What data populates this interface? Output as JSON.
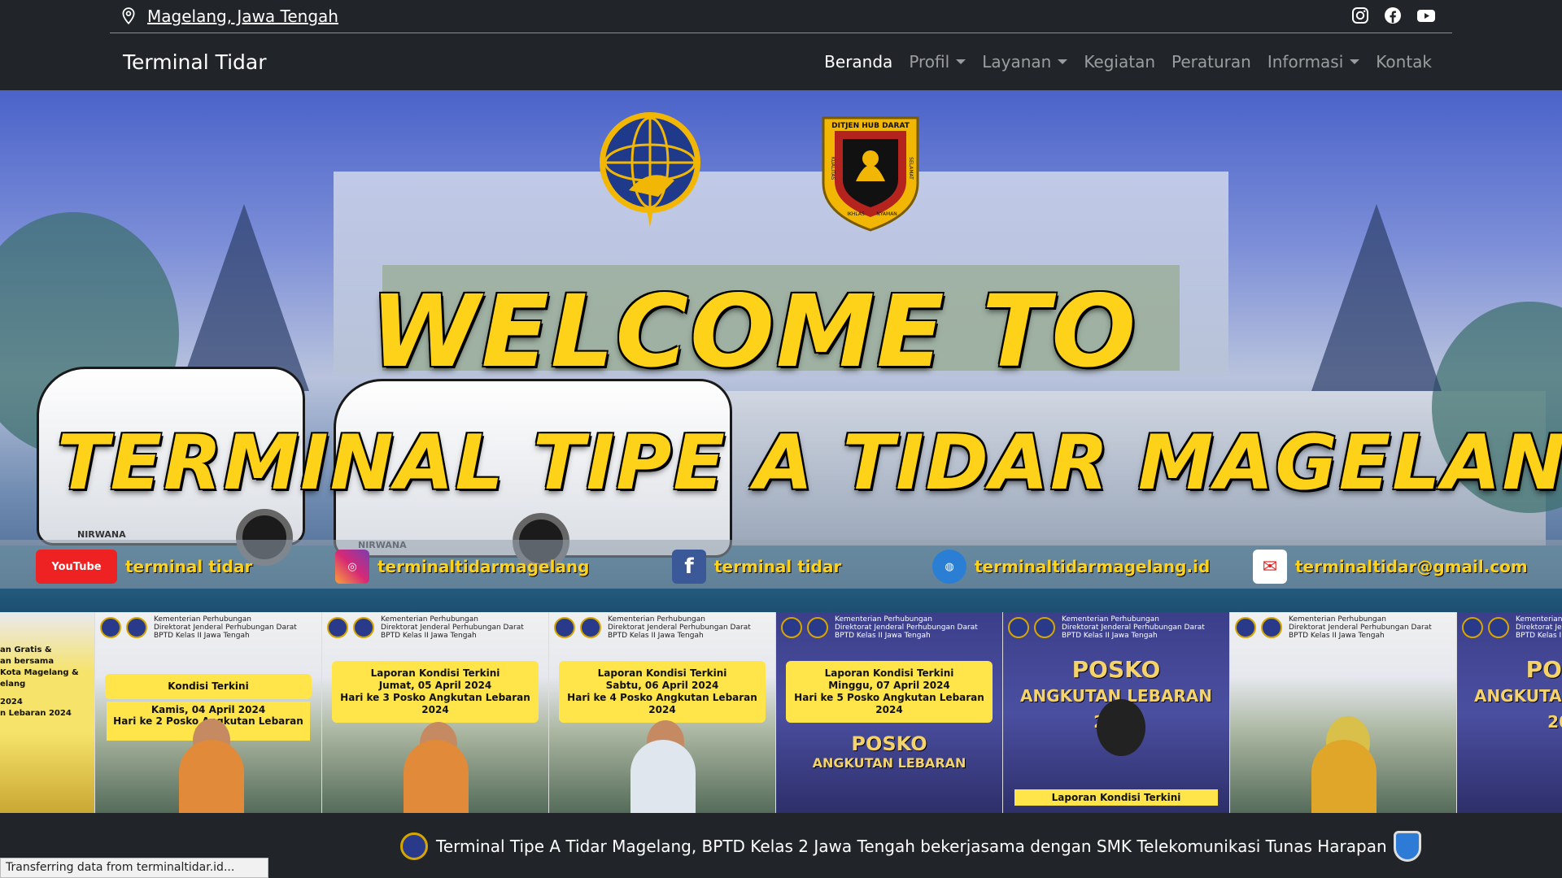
{
  "topbar": {
    "location": "Magelang, Jawa Tengah",
    "social_icons": [
      "instagram-icon",
      "facebook-icon",
      "youtube-icon"
    ]
  },
  "navbar": {
    "brand": "Terminal Tidar",
    "items": [
      {
        "label": "Beranda",
        "active": true
      },
      {
        "label": "Profil",
        "dropdown": true
      },
      {
        "label": "Layanan",
        "dropdown": true
      },
      {
        "label": "Kegiatan"
      },
      {
        "label": "Peraturan"
      },
      {
        "label": "Informasi",
        "dropdown": true
      },
      {
        "label": "Kontak"
      }
    ]
  },
  "hero": {
    "line1": "WELCOME TO",
    "line2": "TERMINAL TIPE A TIDAR MAGELANG",
    "logo2_text": [
      "DITJEN HUB DARAT",
      "KUALITAS",
      "SELAMAT",
      "IKHLAS",
      "NYAMAN"
    ],
    "bus_label": "NIRWANA",
    "socials": {
      "youtube_logo": "YouTube",
      "youtube": "terminal tidar",
      "instagram": "terminaltidarmagelang",
      "facebook": "terminal tidar",
      "web": "terminaltidarmagelang.id",
      "email": "terminaltidar@gmail.com"
    }
  },
  "carousel": {
    "header": [
      "Kementerian Perhubungan",
      "Direktorat Jenderal Perhubungan Darat",
      "BPTD Kelas II Jawa Tengah"
    ],
    "first": [
      "an Gratis &",
      "an bersama",
      "Kota Magelang &",
      "elang",
      "2024",
      "n Lebaran 2024"
    ],
    "tiles": [
      {
        "title": "Kondisi Terkini",
        "date": "Kamis, 04 April 2024",
        "sub": "Hari ke 2 Posko Angkutan Lebaran 2024"
      },
      {
        "title": "Laporan Kondisi Terkini",
        "date": "Jumat, 05 April 2024",
        "sub": "Hari ke 3 Posko Angkutan Lebaran 2024"
      },
      {
        "title": "Laporan Kondisi Terkini",
        "date": "Sabtu, 06 April 2024",
        "sub": "Hari ke 4 Posko Angkutan Lebaran 2024"
      },
      {
        "title": "Laporan Kondisi Terkini",
        "date": "Minggu, 07 April 2024",
        "sub": "Hari ke 5 Posko Angkutan Lebaran 2024"
      }
    ],
    "posko": "POSKO",
    "posko_sub": "ANGKUTAN LEBARAN",
    "year": "2024",
    "laporan": "Laporan Kondisi Terkini"
  },
  "footer": {
    "text": "Terminal Tipe A Tidar Magelang, BPTD Kelas 2 Jawa Tengah bekerjasama dengan SMK Telekomunikasi Tunas Harapan"
  },
  "statusbar": "Transferring data from terminaltidar.id...",
  "colors": {
    "dark": "#212529",
    "title_yellow": "#ffd21a",
    "hero_blue": "#4a63c9"
  }
}
